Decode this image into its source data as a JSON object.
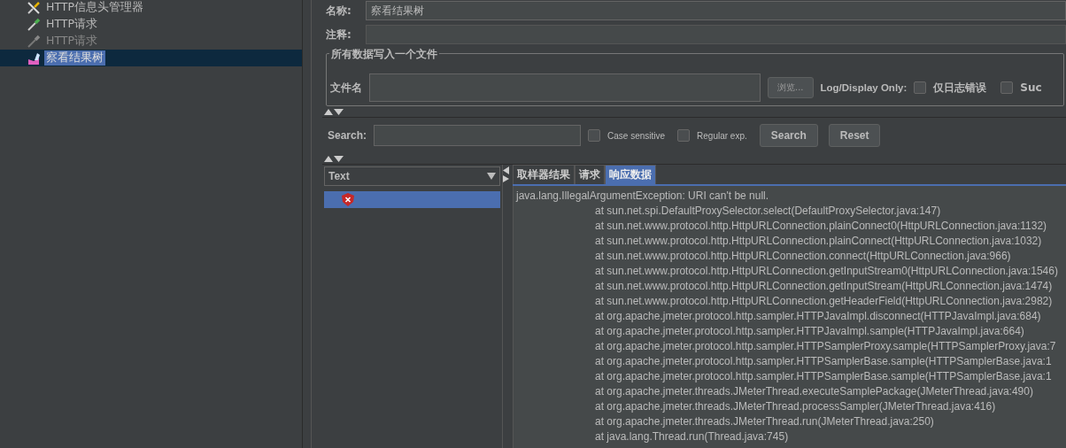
{
  "tree": [
    {
      "label": "HTTP信息头管理器",
      "kind": "tools",
      "disabled": false,
      "selected": false
    },
    {
      "label": "HTTP请求",
      "kind": "pipette",
      "disabled": false,
      "selected": false
    },
    {
      "label": "HTTP请求",
      "kind": "pipette",
      "disabled": true,
      "selected": false
    },
    {
      "label": "察看结果树",
      "kind": "chart",
      "disabled": false,
      "selected": true
    }
  ],
  "name": {
    "label": "名称:",
    "value": "察看结果树"
  },
  "comment": {
    "label": "注释:"
  },
  "file_group": {
    "title": "所有数据写入一个文件",
    "file_label": "文件名",
    "browse": "浏览...",
    "log_label": "Log/Display Only:",
    "options": [
      {
        "label": "仅日志错误",
        "checked": false
      },
      {
        "label": "Suc",
        "checked": false
      }
    ]
  },
  "search": {
    "label": "Search:",
    "options": [
      {
        "label": "Case sensitive",
        "checked": false
      },
      {
        "label": "Regular exp.",
        "checked": false
      }
    ],
    "buttons": [
      "Search",
      "Reset"
    ]
  },
  "renderer": {
    "value": "Text"
  },
  "results": [
    {
      "selected": true
    }
  ],
  "tabs": [
    {
      "label": "取样器结果",
      "selected": false
    },
    {
      "label": "请求",
      "selected": false
    },
    {
      "label": "响应数据",
      "selected": true
    }
  ],
  "response": {
    "lines": [
      "java.lang.IllegalArgumentException: URI can't be null.",
      "at sun.net.spi.DefaultProxySelector.select(DefaultProxySelector.java:147)",
      "at sun.net.www.protocol.http.HttpURLConnection.plainConnect0(HttpURLConnection.java:1132)",
      "at sun.net.www.protocol.http.HttpURLConnection.plainConnect(HttpURLConnection.java:1032)",
      "at sun.net.www.protocol.http.HttpURLConnection.connect(HttpURLConnection.java:966)",
      "at sun.net.www.protocol.http.HttpURLConnection.getInputStream0(HttpURLConnection.java:1546)",
      "at sun.net.www.protocol.http.HttpURLConnection.getInputStream(HttpURLConnection.java:1474)",
      "at sun.net.www.protocol.http.HttpURLConnection.getHeaderField(HttpURLConnection.java:2982)",
      "at org.apache.jmeter.protocol.http.sampler.HTTPJavaImpl.disconnect(HTTPJavaImpl.java:684)",
      "at org.apache.jmeter.protocol.http.sampler.HTTPJavaImpl.sample(HTTPJavaImpl.java:664)",
      "at org.apache.jmeter.protocol.http.sampler.HTTPSamplerProxy.sample(HTTPSamplerProxy.java:7",
      "at org.apache.jmeter.protocol.http.sampler.HTTPSamplerBase.sample(HTTPSamplerBase.java:1",
      "at org.apache.jmeter.protocol.http.sampler.HTTPSamplerBase.sample(HTTPSamplerBase.java:1",
      "at org.apache.jmeter.threads.JMeterThread.executeSamplePackage(JMeterThread.java:490)",
      "at org.apache.jmeter.threads.JMeterThread.processSampler(JMeterThread.java:416)",
      "at org.apache.jmeter.threads.JMeterThread.run(JMeterThread.java:250)",
      "at java.lang.Thread.run(Thread.java:745)"
    ]
  }
}
